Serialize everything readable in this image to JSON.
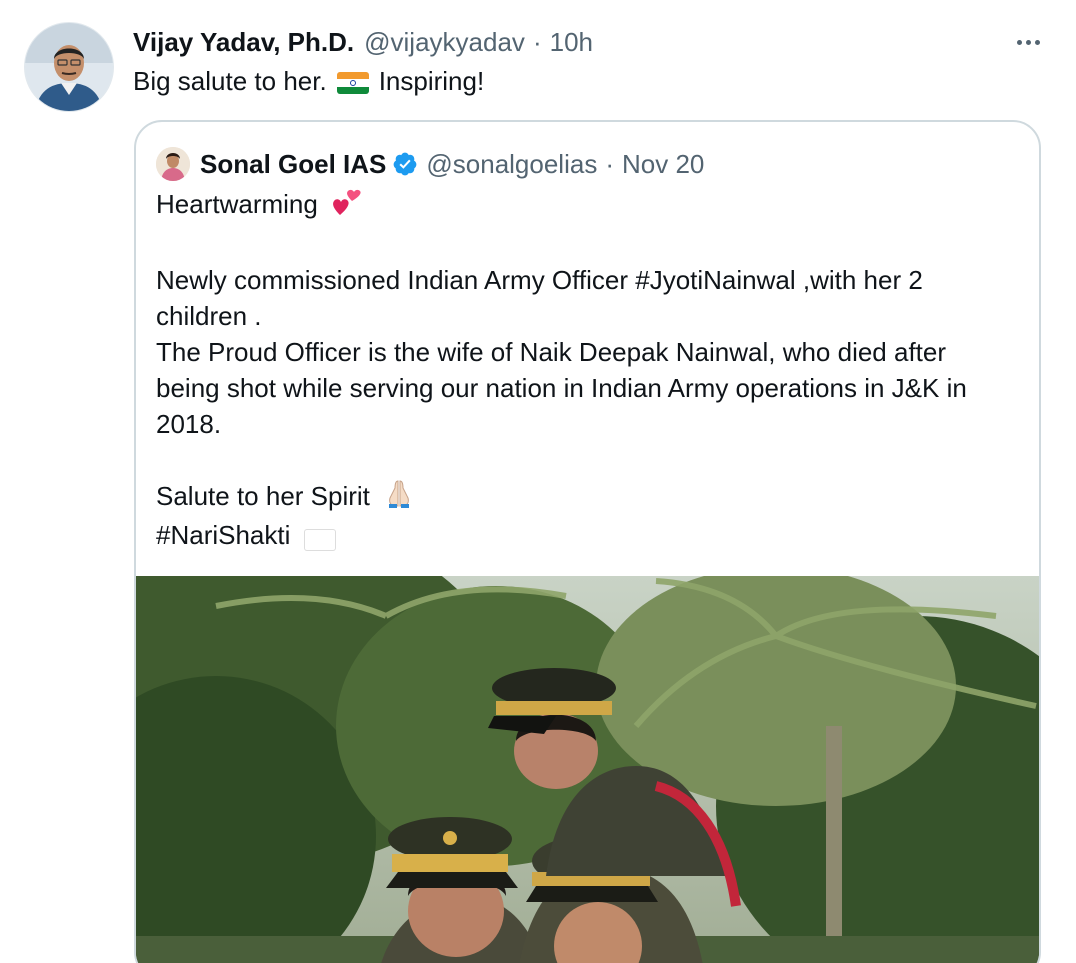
{
  "tweet": {
    "author_name": "Vijay Yadav, Ph.D.",
    "handle": "@vijaykyadav",
    "separator": "·",
    "time": "10h",
    "text_part1": "Big salute to her.",
    "text_part2": "Inspiring!",
    "avatar_icon": "user-avatar",
    "more_icon": "more-options-icon"
  },
  "quoted": {
    "author_name": "Sonal Goel IAS",
    "handle": "@sonalgoelias",
    "separator": "·",
    "date": "Nov 20",
    "verified_icon": "verified-badge-icon",
    "line1": "Heartwarming",
    "line2": "Newly commissioned Indian Army Officer #JyotiNainwal ,with her 2",
    "line3": "children .",
    "line4": "The Proud Officer is the wife of Naik Deepak Nainwal, who died after",
    "line5": "being shot while serving our nation in Indian Army operations in J&K in",
    "line6": "2018.",
    "line7": "Salute to her Spirit",
    "line8": "#NariShakti",
    "emojis": {
      "hearts": "two-hearts-emoji",
      "folded_hands": "folded-hands-emoji",
      "flag": "india-flag-emoji"
    }
  },
  "colors": {
    "text": "#0f1419",
    "secondary": "#536471",
    "border": "#cfd9de",
    "verified": "#1d9bf0"
  }
}
